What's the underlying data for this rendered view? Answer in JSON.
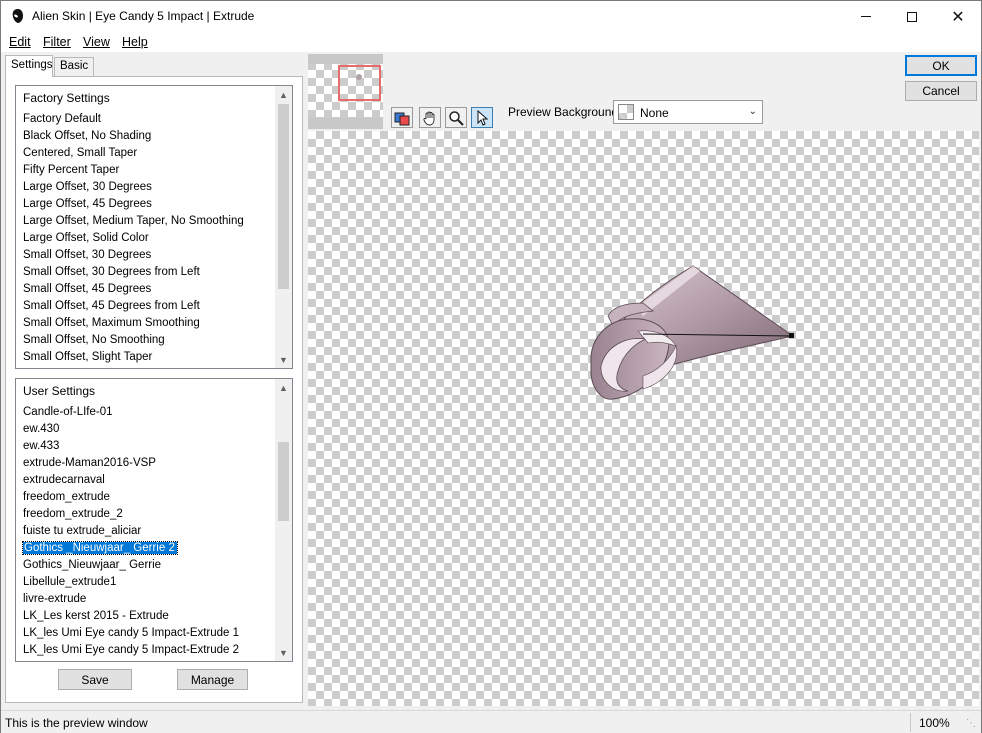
{
  "window": {
    "title": "Alien Skin | Eye Candy 5 Impact | Extrude",
    "minimize_icon": "minimize-icon",
    "maximize_icon": "maximize-icon",
    "close_icon": "close-icon",
    "close_glyph": "✕"
  },
  "menu": {
    "edit": "Edit",
    "filter": "Filter",
    "view": "View",
    "help": "Help"
  },
  "tabs": {
    "settings": "Settings",
    "basic": "Basic"
  },
  "factory_settings": {
    "header": "Factory Settings",
    "items": [
      "Factory Default",
      "Black Offset, No Shading",
      "Centered, Small Taper",
      "Fifty Percent Taper",
      "Large Offset, 30 Degrees",
      "Large Offset, 45 Degrees",
      "Large Offset, Medium Taper, No Smoothing",
      "Large Offset, Solid Color",
      "Small Offset, 30 Degrees",
      "Small Offset, 30 Degrees from Left",
      "Small Offset, 45 Degrees",
      "Small Offset, 45 Degrees from Left",
      "Small Offset, Maximum Smoothing",
      "Small Offset, No Smoothing",
      "Small Offset, Slight Taper"
    ]
  },
  "user_settings": {
    "header": "User Settings",
    "selected_index": 8,
    "items": [
      "Candle-of-LIfe-01",
      "ew.430",
      "ew.433",
      "extrude-Maman2016-VSP",
      "extrudecarnaval",
      "freedom_extrude",
      "freedom_extrude_2",
      "fuiste tu extrude_aliciar",
      "Gothics _Nieuwjaar_ Gerrie 2",
      "Gothics_Nieuwjaar_ Gerrie",
      "Libellule_extrude1",
      "livre-extrude",
      "LK_Les kerst 2015 - Extrude",
      "LK_les Umi Eye candy 5 Impact-Extrude 1",
      "LK_les Umi Eye candy 5 Impact-Extrude 2"
    ]
  },
  "buttons": {
    "save": "Save",
    "manage": "Manage",
    "ok": "OK",
    "cancel": "Cancel"
  },
  "toolbar": {
    "tools": [
      "color-picker-icon",
      "hand-icon",
      "zoom-icon",
      "arrow-pointer-icon"
    ],
    "active_tool": "arrow-pointer-icon",
    "preview_background_label": "Preview Background:",
    "preview_background_value": "None"
  },
  "preview": {
    "shape_color": "#b09aa6",
    "shape_shadow": "#7d6672"
  },
  "status": {
    "text": "This is the preview window",
    "zoom": "100%"
  },
  "colors": {
    "selection": "#0078d7",
    "navigator_frame": "#e86a6a"
  }
}
